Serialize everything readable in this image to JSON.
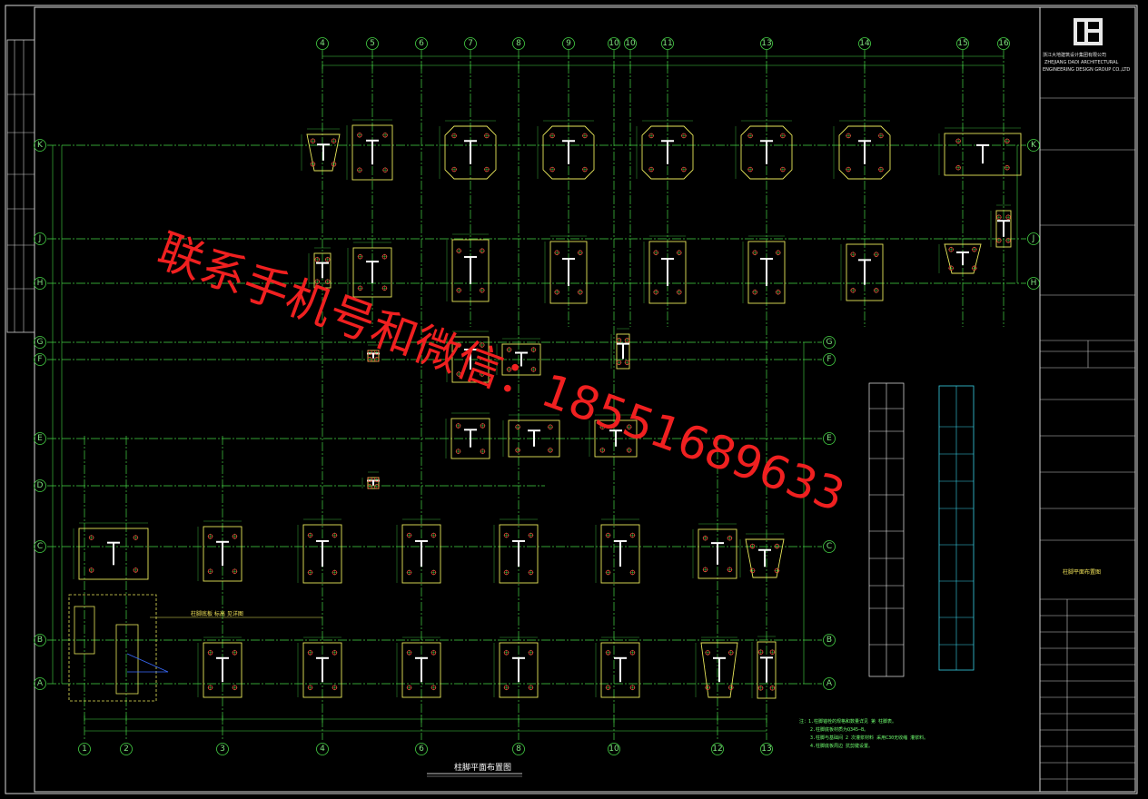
{
  "drawing": {
    "title": "柱脚平面布置图",
    "watermark_text": "联系手机号和微信：18551689633",
    "grid_columns_top": [
      "4",
      "5",
      "6",
      "7",
      "8",
      "9",
      "10",
      "10",
      "11",
      "13",
      "14",
      "15",
      "16"
    ],
    "grid_columns_bottom": [
      "1",
      "2",
      "3",
      "4",
      "6",
      "8",
      "10",
      "12",
      "13"
    ],
    "grid_rows_left": [
      "K",
      "J",
      "H",
      "G",
      "F",
      "E",
      "D",
      "C",
      "B",
      "A"
    ],
    "grid_rows_right": [
      "K",
      "J",
      "H",
      "G",
      "F",
      "E",
      "C",
      "B",
      "A"
    ],
    "notes": [
      "注：1.柱脚锚栓的规格和数量详见 第 柱脚表。",
      "2.柱脚底板材质为Q345—B。",
      "3.柱脚与基础间 2 次灌浆材料 采用C30无收缩 灌浆料。",
      "4.柱脚底板周边  抗剪键设置。"
    ]
  },
  "colors": {
    "background": "#000000",
    "grid": "#45d445",
    "plate": "#e8e65a",
    "anchor": "#ff3a3a",
    "text": "#ffffff",
    "table_cyan": "#36d0e6",
    "watermark": "#f02020"
  },
  "title_block": {
    "company_cn": "浙江大地建筑设计集团有限公司",
    "company_en1": "ZHEJIANG DADI ARCHITECTURAL",
    "company_en2": "ENGINEERING DESIGN GROUP CO.,LTD",
    "project_title": "柱脚平面布置图"
  }
}
